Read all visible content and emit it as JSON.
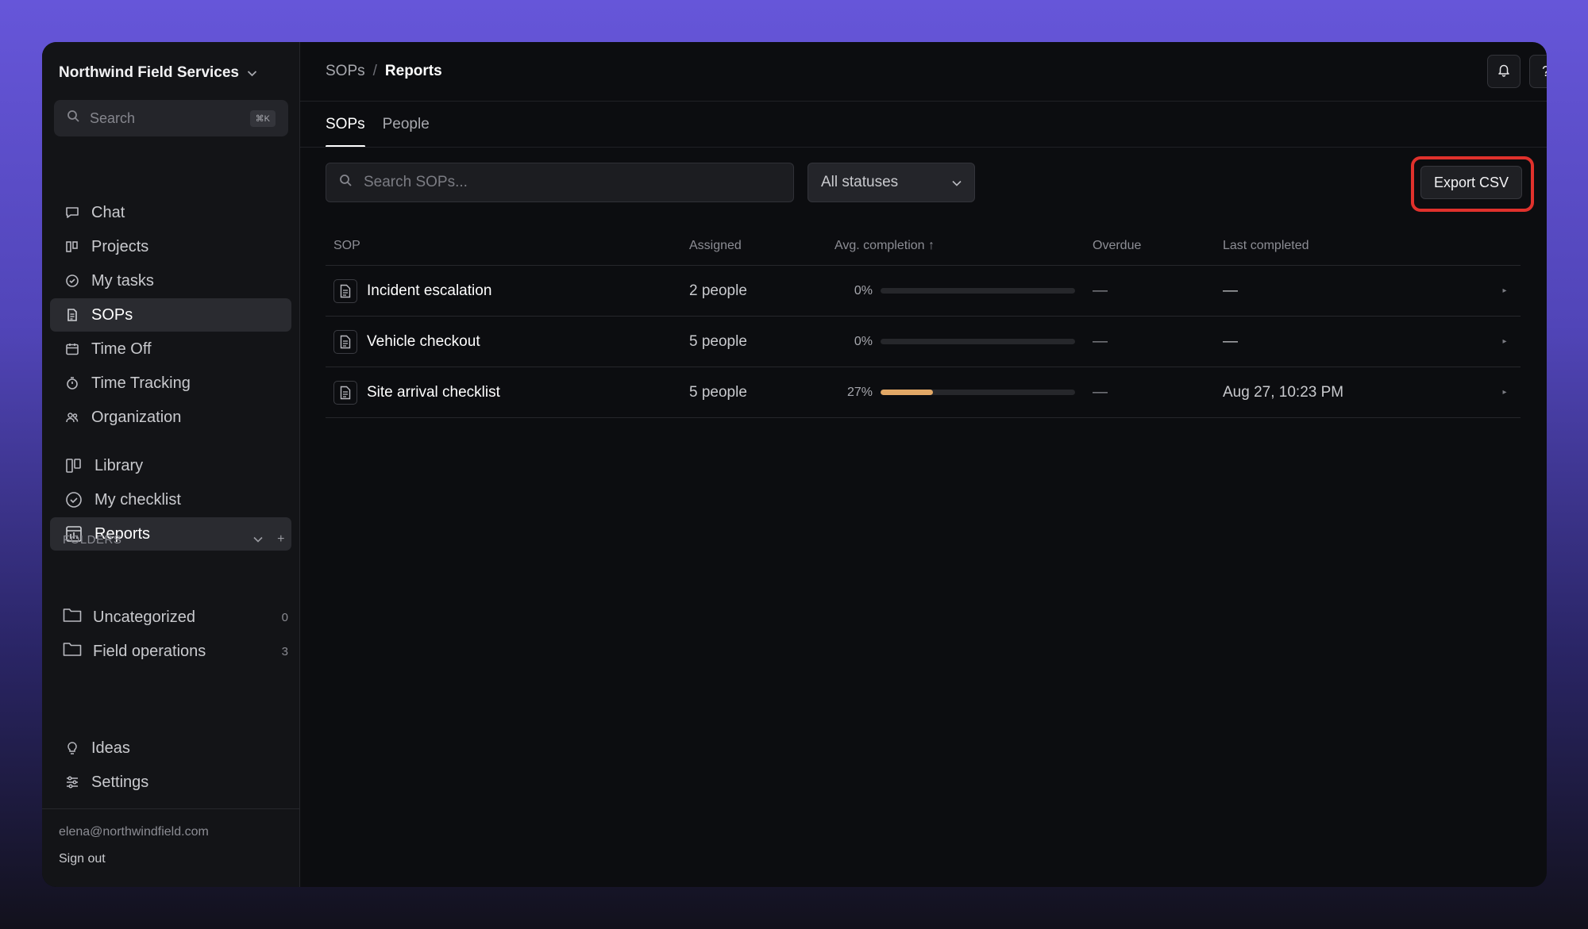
{
  "org": {
    "name": "Northwind Field Services"
  },
  "sidebar": {
    "search_placeholder": "Search",
    "search_shortcut": "⌘K",
    "nav": [
      {
        "label": "Chat",
        "icon": "chat-icon"
      },
      {
        "label": "Projects",
        "icon": "projects-icon"
      },
      {
        "label": "My tasks",
        "icon": "check-circle-icon"
      },
      {
        "label": "SOPs",
        "icon": "document-icon",
        "active": true
      },
      {
        "label": "Time Off",
        "icon": "calendar-icon"
      },
      {
        "label": "Time Tracking",
        "icon": "stopwatch-icon"
      },
      {
        "label": "Organization",
        "icon": "people-icon"
      }
    ],
    "sub_nav": [
      {
        "label": "Library",
        "icon": "library-icon"
      },
      {
        "label": "My checklist",
        "icon": "check-circle-icon"
      },
      {
        "label": "Reports",
        "icon": "report-icon",
        "active": true
      }
    ],
    "folders_header": "FOLDERS",
    "folders": [
      {
        "label": "Uncategorized",
        "count": "0"
      },
      {
        "label": "Field operations",
        "count": "3"
      }
    ],
    "bottom": [
      {
        "label": "Ideas",
        "icon": "lightbulb-icon"
      },
      {
        "label": "Settings",
        "icon": "sliders-icon"
      }
    ],
    "email": "elena@northwindfield.com",
    "signout": "Sign out"
  },
  "header": {
    "breadcrumb_parent": "SOPs",
    "breadcrumb_sep": "/",
    "breadcrumb_current": "Reports",
    "help_label": "?"
  },
  "tabs": [
    {
      "label": "SOPs",
      "active": true
    },
    {
      "label": "People",
      "active": false
    }
  ],
  "filters": {
    "search_placeholder": "Search SOPs...",
    "status_value": "All statuses",
    "export_label": "Export CSV"
  },
  "table": {
    "headers": {
      "sop": "SOP",
      "assigned": "Assigned",
      "avg": "Avg. completion ↑",
      "overdue": "Overdue",
      "last": "Last completed"
    },
    "rows": [
      {
        "name": "Incident escalation",
        "assigned": "2 people",
        "pct_label": "0%",
        "pct": 0,
        "overdue": "—",
        "last": "—"
      },
      {
        "name": "Vehicle checkout",
        "assigned": "5 people",
        "pct_label": "0%",
        "pct": 0,
        "overdue": "—",
        "last": "—"
      },
      {
        "name": "Site arrival checklist",
        "assigned": "5 people",
        "pct_label": "27%",
        "pct": 27,
        "overdue": "—",
        "last": "Aug 27, 10:23 PM"
      }
    ]
  },
  "colors": {
    "accent_progress": "#e2a866",
    "highlight": "#e0312c"
  }
}
